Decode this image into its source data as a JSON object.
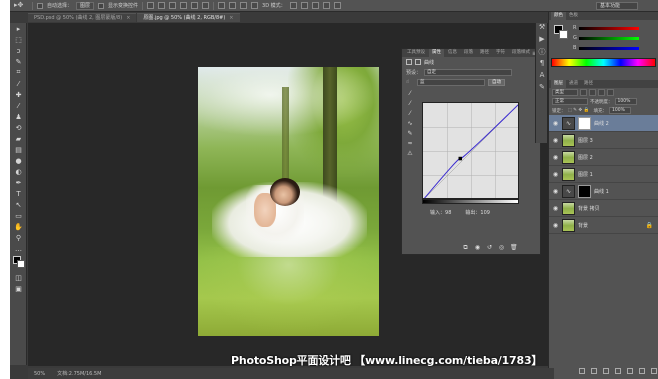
{
  "options_bar": {
    "auto_select_label": "自动选择：",
    "auto_select_value": "图层",
    "show_transform_label": "显示变换控件",
    "mode_3d_label": "3D 模式：",
    "workspace": "基本功能"
  },
  "tabs": [
    {
      "label": "PSD.psd @ 50% (曲线 2, 图层蒙版/8)",
      "close": "×"
    },
    {
      "label": "原图.jpg @ 50% (曲线 2, RGB/8#)",
      "close": "×"
    }
  ],
  "watermark": "PhotoShop平面设计吧 【www.linecg.com/tieba/1783】",
  "status": {
    "zoom": "50%",
    "doc_size": "文档:2.75M/16.5M"
  },
  "properties": {
    "tabs": [
      "工具预设",
      "属性",
      "信息",
      "段落",
      "路径",
      "字符",
      "段落样式"
    ],
    "active_tab": "属性",
    "title": "曲线",
    "preset_label": "预设：",
    "preset_value": "自定",
    "channel_value": "蓝",
    "auto_button": "自动",
    "input_label": "输入：",
    "input_value": "98",
    "output_label": "输出：",
    "output_value": "109"
  },
  "color_panel": {
    "tabs": [
      "颜色",
      "色板"
    ],
    "active_tab": "颜色",
    "r_label": "R",
    "g_label": "G",
    "b_label": "B"
  },
  "layers_panel": {
    "tabs": [
      "图层",
      "通道",
      "路径"
    ],
    "active_tab": "图层",
    "kind_filter": "类型",
    "blend_mode": "正常",
    "opacity_label": "不透明度：",
    "opacity_value": "100%",
    "lock_label": "锁定：",
    "fill_label": "填充：",
    "fill_value": "100%",
    "layers": [
      {
        "name": "曲线 2",
        "type": "adjustment",
        "selected": true,
        "mask": "white"
      },
      {
        "name": "图层 3",
        "type": "pixel",
        "selected": false
      },
      {
        "name": "图层 2",
        "type": "pixel",
        "selected": false
      },
      {
        "name": "图层 1",
        "type": "pixel",
        "selected": false
      },
      {
        "name": "曲线 1",
        "type": "adjustment",
        "selected": false,
        "mask": "black"
      },
      {
        "name": "背景 拷贝",
        "type": "pixel",
        "selected": false
      },
      {
        "name": "背景",
        "type": "pixel",
        "selected": false,
        "locked": true
      }
    ]
  },
  "curve": {
    "points": [
      [
        0,
        0
      ],
      [
        98,
        109
      ],
      [
        255,
        255
      ]
    ],
    "line_color": "#3a2ad0"
  },
  "icons": {
    "move": "move-icon",
    "marquee": "marquee-icon",
    "lasso": "lasso-icon",
    "eye": "eye-icon",
    "lock": "lock-icon"
  }
}
